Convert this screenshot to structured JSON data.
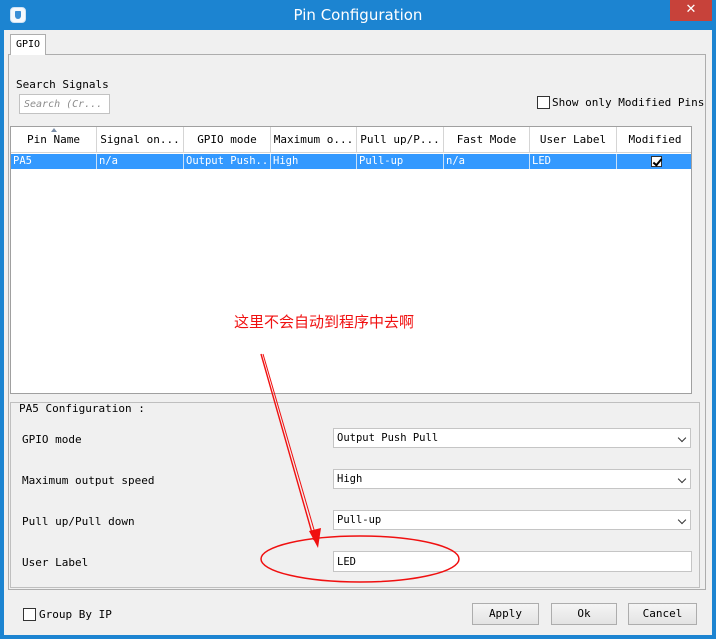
{
  "window": {
    "title": "Pin Configuration",
    "close_glyph": "✕"
  },
  "tabs": [
    {
      "label": "GPIO"
    }
  ],
  "search": {
    "label": "Search Signals",
    "placeholder": "Search (Cr..."
  },
  "show_modified": {
    "label": "Show only Modified Pins",
    "checked": false
  },
  "table": {
    "columns": [
      "Pin Name",
      "Signal on...",
      "GPIO mode",
      "Maximum o...",
      "Pull up/P...",
      "Fast Mode",
      "User Label",
      "Modified"
    ],
    "rows": [
      {
        "pin_name": "PA5",
        "signal": "n/a",
        "gpio_mode": "Output Push...",
        "max_speed": "High",
        "pull": "Pull-up",
        "fast_mode": "n/a",
        "user_label": "LED",
        "modified": true
      }
    ]
  },
  "annotation": {
    "text": "这里不会自动到程序中去啊",
    "color": "#f01010"
  },
  "config": {
    "title": "PA5 Configuration :",
    "fields": [
      {
        "label": "GPIO mode",
        "value": "Output Push Pull"
      },
      {
        "label": "Maximum output speed",
        "value": "High"
      },
      {
        "label": "Pull up/Pull down",
        "value": "Pull-up"
      },
      {
        "label": "User Label",
        "value": "LED"
      }
    ]
  },
  "group_by_ip": {
    "label": "Group By IP",
    "checked": false
  },
  "buttons": {
    "apply": "Apply",
    "ok": "Ok",
    "cancel": "Cancel"
  },
  "colors": {
    "titlebar": "#1c84d1",
    "selection": "#3399ff",
    "close_button": "#c7423a",
    "annotation": "#f01010"
  },
  "icons": {
    "app": "cube-app-icon",
    "close": "close-icon",
    "sort": "sort-ascending-icon",
    "check": "checkmark-icon",
    "dropdown": "chevron-down-icon"
  }
}
